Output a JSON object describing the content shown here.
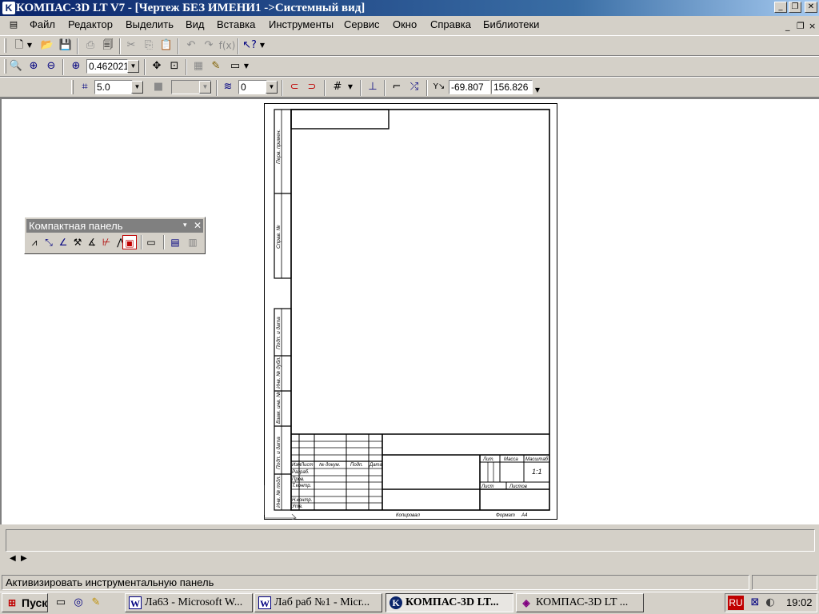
{
  "window": {
    "title": "КОМПАС-3D LT V7 - [Чертеж БЕЗ ИМЕНИ1 ->Системный вид]",
    "buttons": [
      "_",
      "❐",
      "✕"
    ]
  },
  "menu": {
    "items": [
      "Файл",
      "Редактор",
      "Выделить",
      "Вид",
      "Вставка",
      "Инструменты",
      "Сервис",
      "Окно",
      "Справка",
      "Библиотеки"
    ],
    "mdi_buttons": [
      "_",
      "❐",
      "×"
    ]
  },
  "view_toolbar": {
    "zoom_value": "0.462021"
  },
  "current_state": {
    "step_value": "5.0",
    "layer_value": "0",
    "x_value": "-69.807",
    "y_value": "156.826"
  },
  "compact_panel": {
    "title": "Компактная панель"
  },
  "drawing": {
    "stamp_labels": {
      "izm": "Изм",
      "list": "Лист",
      "ndokum": "№ докум.",
      "podp": "Подп.",
      "data": "Дата",
      "razrab": "Разраб.",
      "prov": "Пров.",
      "tkontr": "Т.контр.",
      "nkontr": "Н.контр.",
      "utv": "Утв.",
      "lit": "Лит.",
      "massa": "Масса",
      "masshtab": "Масштаб",
      "scale_value": "1:1",
      "list2": "Лист",
      "listov": "Листов",
      "kopiroval": "Копировал",
      "format": "Формат",
      "format_value": "А4"
    },
    "side_labels": [
      "Перв. примен.",
      "Справ. №",
      "Подп. и дата",
      "Инв. № дубл.",
      "Взам. инв. №",
      "Подп. и дата",
      "Инв. № подл."
    ]
  },
  "status": {
    "hint": "Активизировать инструментальную панель"
  },
  "taskbar": {
    "start": "Пуск",
    "tasks": [
      "Ла63 - Microsoft W...",
      "Лаб раб №1 - Micr...",
      "КОМПАС-3D LT...",
      "КОМПАС-3D LT ..."
    ],
    "lang": "RU",
    "clock": "19:02"
  }
}
